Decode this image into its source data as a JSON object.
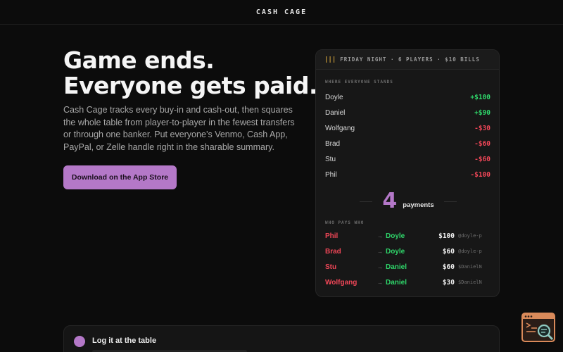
{
  "header": {
    "brand": "CASH CAGE"
  },
  "hero": {
    "title_line1": "Game ends.",
    "title_line2": "Everyone gets paid.",
    "description": "Cash Cage tracks every buy-in and cash-out, then squares the whole table from player-to-player in the fewest transfers or through one banker. Put everyone’s Venmo, Cash App, PayPal, or Zelle handle right in the sharable summary.",
    "cta_label": "Download on the App Store"
  },
  "card": {
    "header_icon": "|||",
    "header_text": "FRIDAY NIGHT · 6 PLAYERS · $10 BILLS",
    "standings_label": "WHERE EVERYONE STANDS",
    "standings": [
      {
        "name": "Doyle",
        "amount": "+$100",
        "status": "positive"
      },
      {
        "name": "Daniel",
        "amount": "+$90",
        "status": "positive"
      },
      {
        "name": "Wolfgang",
        "amount": "-$30",
        "status": "negative"
      },
      {
        "name": "Brad",
        "amount": "-$60",
        "status": "negative"
      },
      {
        "name": "Stu",
        "amount": "-$60",
        "status": "negative"
      },
      {
        "name": "Phil",
        "amount": "-$100",
        "status": "negative"
      }
    ],
    "payment_count": "4",
    "payment_word": "payments",
    "payments_label": "WHO PAYS WHO",
    "arrow": "→",
    "payments": [
      {
        "from": "Phil",
        "to": "Doyle",
        "amount": "$100",
        "handle": "@doyle-p"
      },
      {
        "from": "Brad",
        "to": "Doyle",
        "amount": "$60",
        "handle": "@doyle-p"
      },
      {
        "from": "Stu",
        "to": "Daniel",
        "amount": "$60",
        "handle": "$DanielN"
      },
      {
        "from": "Wolfgang",
        "to": "Daniel",
        "amount": "$30",
        "handle": "$DanielN"
      }
    ]
  },
  "step": {
    "title": "Log it at the table"
  },
  "colors": {
    "accent": "#b478c8",
    "positive": "#2fd66a",
    "negative": "#ef4657",
    "background": "#0c0c0c",
    "widget_border": "#d98a5a",
    "widget_fill": "#2a1d17",
    "widget_glyph": "#8fc9c0"
  },
  "icons": {
    "header_icon": "bars-icon",
    "widget_icon": "terminal-search-icon",
    "step_icon": "step-dot-icon"
  }
}
